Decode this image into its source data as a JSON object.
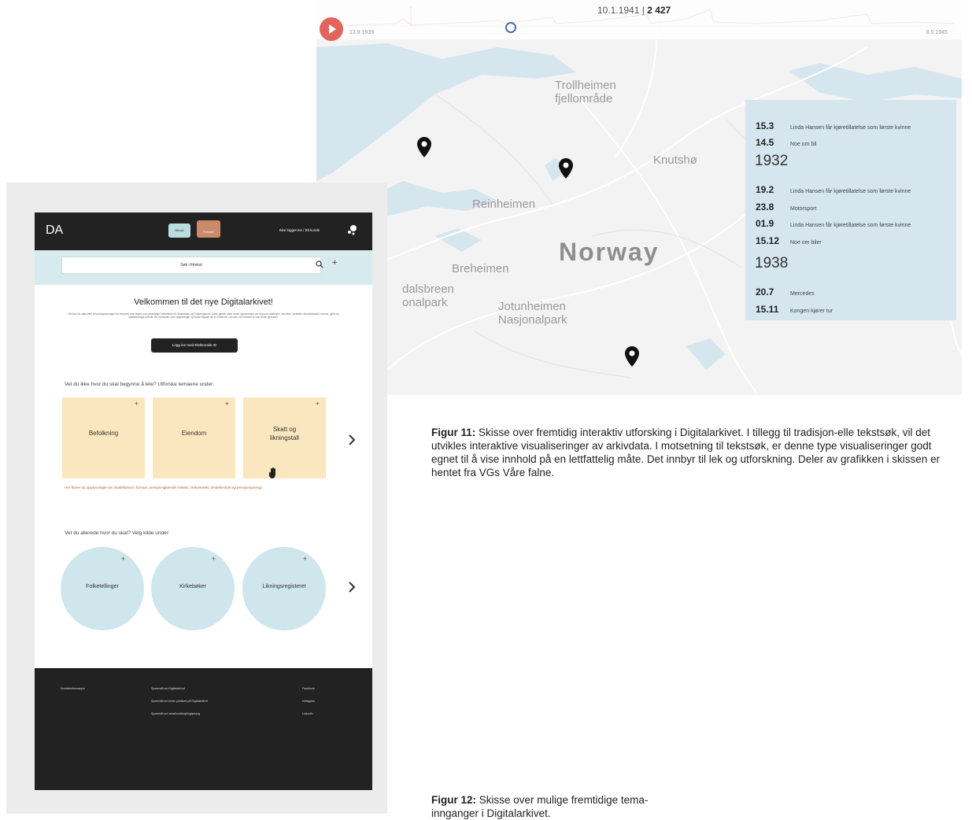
{
  "map": {
    "timeline": {
      "date": "10.1.1941",
      "count": "2 427",
      "start_label": "13.8.1939",
      "end_label": "8.5.1945",
      "position_fraction": 0.27
    },
    "labels": {
      "trollheimen": "Trollheimen\nfjellområde",
      "knutsho": "Knutshø",
      "reinheimen": "Reinheimen",
      "norway": "Norway",
      "breheimen": "Breheimen",
      "dalsbreen": "dalsbreen\nonalpark",
      "jotunheimen": "Jotunheimen\nNasjonalpark"
    },
    "events": [
      {
        "date": "15.3",
        "text": "Linda Hansen får kjøretillatelse som første kvinne"
      },
      {
        "date": "14.5",
        "text": "Noe om bil"
      },
      {
        "year": "1932"
      },
      {
        "date": "19.2",
        "text": "Linda Hansen får kjøretillatelse som første kvinne"
      },
      {
        "date": "23.8",
        "text": "Motorsport"
      },
      {
        "date": "01.9",
        "text": "Linda Hansen får kjøretillatelse som første kvinne"
      },
      {
        "date": "15.12",
        "text": "Noe om biler"
      },
      {
        "year": "1938"
      },
      {
        "date": "20.7",
        "text": "Mercedes"
      },
      {
        "date": "15.11",
        "text": "Kongen kjører tur"
      }
    ],
    "colors": {
      "accent": "#e1655c",
      "panel": "#d6e6ef"
    }
  },
  "captions": {
    "fig11_label": "Figur 11:",
    "fig11_text": " Skisse over fremtidig interaktiv utforsking i Digitalarkivet. I tillegg til tradisjon-elle tekstsøk, vil det utvikles interaktive visualiseringer av arkivdata. I motsetning til tekstsøk, er denne type visualiseringer godt egnet til å vise innhold på en lettfattelig måte. Det innbyr til lek og utforskning. Deler av grafikken i skissen er hentet fra VGs Våre falne.",
    "fig12_label": "Figur 12:",
    "fig12_text": " Skisse over mulige fremtidige tema­innganger i Digitalarkivet."
  },
  "site": {
    "logo": "DA",
    "bubble_blue": "Besøk",
    "bubble_brown": "Forsker",
    "login_link": "Ikke logget inn / Bli kunde",
    "search_placeholder": "Søk i fritekst",
    "welcome_title": "Velkommen til det nye Digitalarkivet!",
    "intro_text": "Her kan du søke etter personopplysninger om deg selv som lagres som personlige forbindelse fra Skattetaten og Folkeregisteret. Dette gjelder blant annet opplysninger om deg som skatteyter, eiendom, inntekter, arbeidsforhold, formue, gjeld og skattemessige forhold. Se oversikten over opplysninger og hvilke registre de er hentet fra. Les mer om hvordan du kan bruke tjenesten.",
    "bankid_button": "Logg inn med Elektronisk ID",
    "themes_title": "Vet du ikke hvor du skal begynne å lete? Utforske temaene under:",
    "themes": [
      "Befolkning",
      "Eiendom",
      "Skatt og\nlikningstall"
    ],
    "theme_note": "Her finner du opplysninger om skatteklasse, formue, pensjonsgivende inntekt, nettoinntekt, inntektsskatt og pensjonspoeng.",
    "sources_title": "Vet du allerede hvor du skal? Velg kilde under:",
    "sources": [
      "Folketellinger",
      "Kirkebøker",
      "Likningsregisteret"
    ],
    "footer": {
      "col1": [
        "Kontaktinformasjon"
      ],
      "col2": [
        "Spørsmål om Digitalarkivet",
        "Spørsmål om kilder publisert på Digitalarkivet",
        "Spørsmål om arealfordeling/tinglysning"
      ],
      "col3": [
        "Facebook",
        "Instagram",
        "LinkedIn"
      ]
    },
    "colors": {
      "theme_card": "#fbe7bf",
      "source_circle": "#cfe6ec",
      "header": "#222222"
    }
  }
}
